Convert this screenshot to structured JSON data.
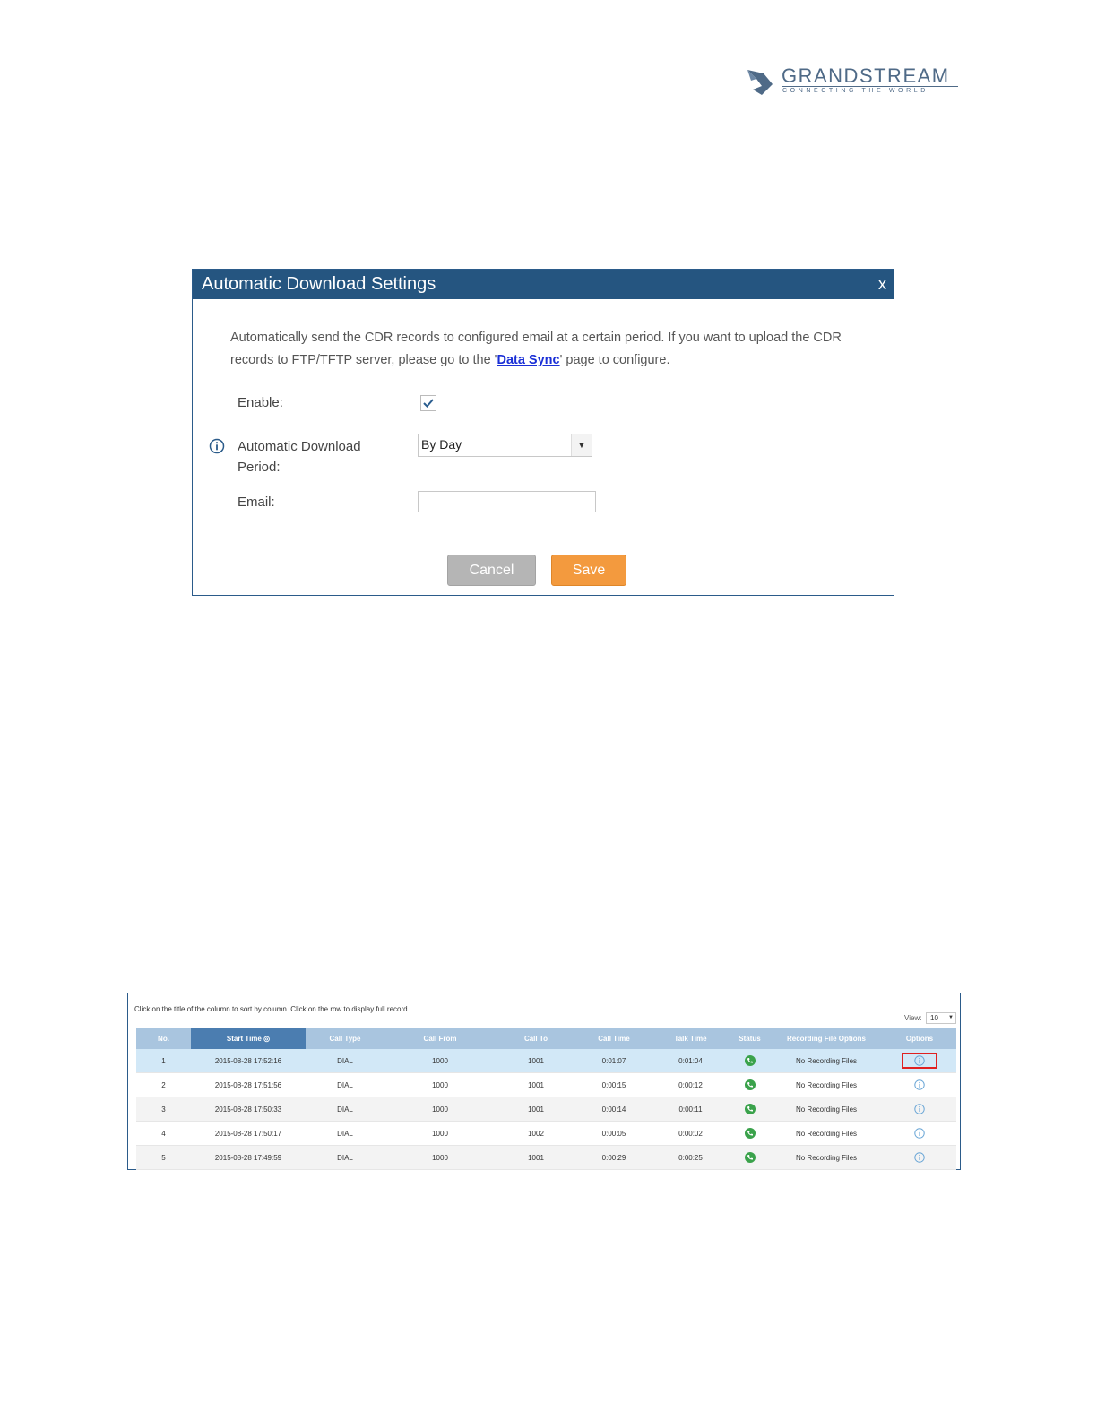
{
  "brand": {
    "name": "GRANDSTREAM",
    "tagline": "CONNECTING THE WORLD",
    "color": "#4f6a87"
  },
  "dialog": {
    "title": "Automatic Download Settings",
    "close": "x",
    "description_pre": "Automatically send the CDR records to configured email at a certain period. If you want to upload the CDR records to FTP/TFTP server, please go to the '",
    "description_link": "Data Sync",
    "description_post": "' page to configure.",
    "enable_label": "Enable:",
    "enable_checked": true,
    "period_label_line1": "Automatic Download",
    "period_label_line2": "Period:",
    "period_value": "By Day",
    "email_label": "Email:",
    "email_value": "",
    "cancel_label": "Cancel",
    "save_label": "Save",
    "header_color": "#255580",
    "save_color": "#f39a3e",
    "cancel_color": "#b5b5b5"
  },
  "cdr": {
    "hint": "Click on the title of the column to sort by column. Click on the row to display full record.",
    "view_label": "View:",
    "view_value": "10",
    "columns": [
      "No.",
      "Start Time",
      "Call Type",
      "Call From",
      "Call To",
      "Call Time",
      "Talk Time",
      "Status",
      "Recording File Options",
      "Options"
    ],
    "rows": [
      {
        "no": "1",
        "start": "2015-08-28 17:52:16",
        "type": "DIAL",
        "from": "1000",
        "to": "1001",
        "call_time": "0:01:07",
        "talk_time": "0:01:04",
        "recording": "No Recording Files"
      },
      {
        "no": "2",
        "start": "2015-08-28 17:51:56",
        "type": "DIAL",
        "from": "1000",
        "to": "1001",
        "call_time": "0:00:15",
        "talk_time": "0:00:12",
        "recording": "No Recording Files"
      },
      {
        "no": "3",
        "start": "2015-08-28 17:50:33",
        "type": "DIAL",
        "from": "1000",
        "to": "1001",
        "call_time": "0:00:14",
        "talk_time": "0:00:11",
        "recording": "No Recording Files"
      },
      {
        "no": "4",
        "start": "2015-08-28 17:50:17",
        "type": "DIAL",
        "from": "1000",
        "to": "1002",
        "call_time": "0:00:05",
        "talk_time": "0:00:02",
        "recording": "No Recording Files"
      },
      {
        "no": "5",
        "start": "2015-08-28 17:49:59",
        "type": "DIAL",
        "from": "1000",
        "to": "1001",
        "call_time": "0:00:29",
        "talk_time": "0:00:25",
        "recording": "No Recording Files"
      }
    ],
    "status_color": "#3aa24b",
    "highlight_color": "#e02020"
  }
}
